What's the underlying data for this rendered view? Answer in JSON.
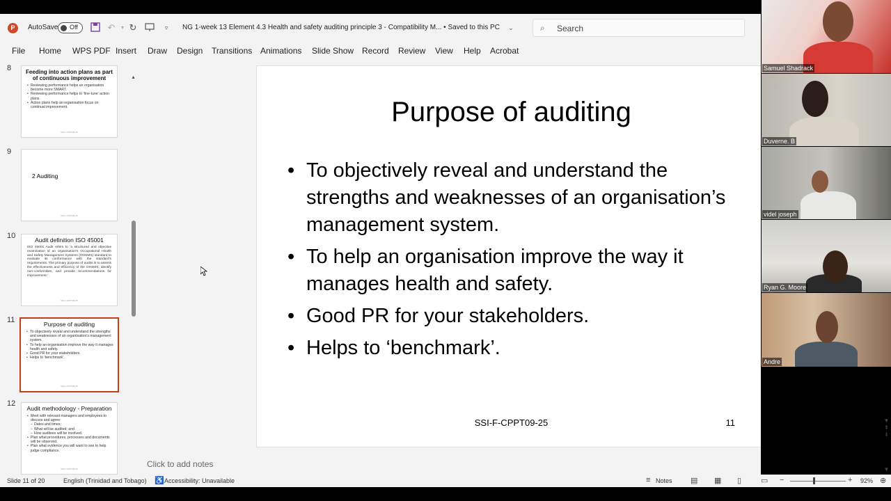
{
  "titlebar": {
    "autosave_label": "AutoSave",
    "autosave_state": "Off",
    "document_title": "NG 1-week 13 Element 4.3 Health and safety auditing principle 3  -  Compatibility M...  •  Saved to this PC",
    "search_placeholder": "Search"
  },
  "menu": [
    "File",
    "Home",
    "WPS PDF",
    "Insert",
    "Draw",
    "Design",
    "Transitions",
    "Animations",
    "Slide Show",
    "Record",
    "Review",
    "View",
    "Help",
    "Acrobat"
  ],
  "thumbnails": [
    {
      "number": "8",
      "title": "Feeding into action plans as part of continuous improvement",
      "bullets": [
        "Reviewing performance helps an organisation become more SMART.",
        "Reviewing performance helps to 'fine-tune' action plans.",
        "Action plans help an organisation focus on continual improvement."
      ],
      "footer": "SSI-F-CPPT09-25"
    },
    {
      "number": "9",
      "section": "2    Auditing",
      "footer": "SSI-F-CPPT09-25"
    },
    {
      "number": "10",
      "title": "Audit definition ISO 45001",
      "para": "ISO 45001 Audit refers to 'a structured and objective examination of an organisation's Occupational Health and Safety Management Systems (OHSMS) standard to evaluate its conformance with the standard's requirements. The primary purpose of audits is to assess the effectiveness and efficiency of the OHSMS, identify non-conformities, and provide recommendations for improvement.'",
      "footer": "SSI-F-CPPT09-25"
    },
    {
      "number": "11",
      "title": "Purpose of auditing",
      "bullets": [
        "To objectively reveal and understand the strengths and weaknesses of an organisation's management system.",
        "To help an organisation improve the way it manages health and safety.",
        "Good PR for your stakeholders.",
        "Helps to 'benchmark'."
      ],
      "footer": "SSI-F-CPPT09-25"
    },
    {
      "number": "12",
      "title": "Audit methodology - Preparation",
      "bullets": [
        "Meet with relevant managers and employees to discuss and agree:"
      ],
      "subs": [
        "Dates and times;",
        "What will be audited; and",
        "How auditees will be involved."
      ],
      "bullets2": [
        "Plan what procedures, processes and documents will be observed.",
        "Plan what evidence you will want to see to help judge compliance."
      ],
      "footer": "SSI-F-CPPT09-25"
    }
  ],
  "slide": {
    "title": "Purpose of auditing",
    "bullets": [
      "To objectively reveal and understand the strengths and weaknesses of an organisation’s management system.",
      "To help an organisation improve the way it manages health and safety.",
      "Good PR for your stakeholders.",
      "Helps to ‘benchmark’."
    ],
    "footer": "SSI-F-CPPT09-25",
    "number": "11"
  },
  "notes_placeholder": "Click to add notes",
  "status": {
    "slide_info": "Slide 11 of 20",
    "language": "English (Trinidad and Tobago)",
    "accessibility": "Accessibility: Unavailable",
    "notes_label": "Notes",
    "zoom": "92%"
  },
  "participants": [
    "Samuel Shadrack",
    "Duverne. B",
    "videl joseph",
    "Ryan G. Moore",
    "Andre"
  ],
  "colors": {
    "accent": "#c43e1c",
    "ppt_logo": "#d24726"
  }
}
